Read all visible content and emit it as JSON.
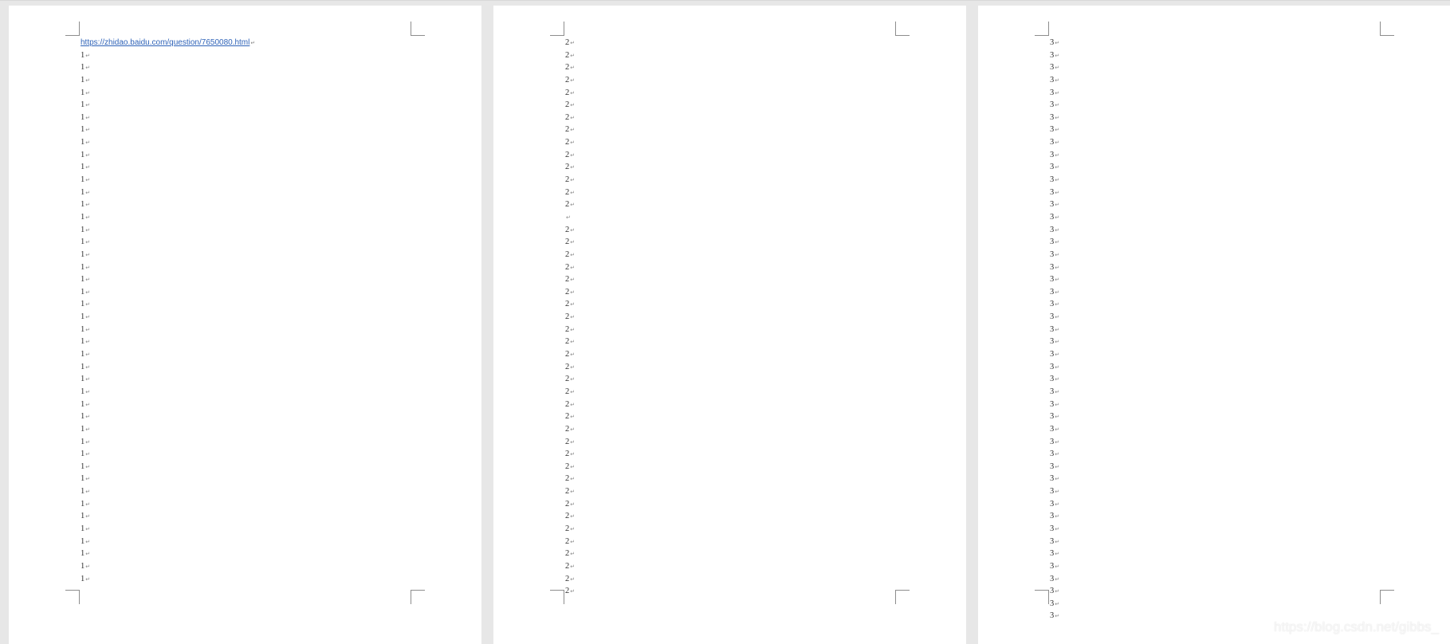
{
  "document": {
    "pages": [
      {
        "name": "page-1",
        "link_text": "https://zhidao.baidu.com/question/7650080.html",
        "lines": [
          "1",
          "1",
          "1",
          "1",
          "1",
          "1",
          "1",
          "1",
          "1",
          "1",
          "1",
          "1",
          "1",
          "1",
          "1",
          "1",
          "1",
          "1",
          "1",
          "1",
          "1",
          "1",
          "1",
          "1",
          "1",
          "1",
          "1",
          "1",
          "1",
          "1",
          "1",
          "1",
          "1",
          "1",
          "1",
          "1",
          "1",
          "1",
          "1",
          "1",
          "1",
          "1",
          "1"
        ]
      },
      {
        "name": "page-2",
        "lines": [
          "2",
          "2",
          "2",
          "2",
          "2",
          "2",
          "2",
          "2",
          "2",
          "2",
          "2",
          "2",
          "2",
          "2",
          "",
          "2",
          "2",
          "2",
          "2",
          "2",
          "2",
          "2",
          "2",
          "2",
          "2",
          "2",
          "2",
          "2",
          "2",
          "2",
          "2",
          "2",
          "2",
          "2",
          "2",
          "2",
          "2",
          "2",
          "2",
          "2",
          "2",
          "2",
          "2",
          "2",
          "2"
        ]
      },
      {
        "name": "page-3",
        "lines": [
          "3",
          "3",
          "3",
          "3",
          "3",
          "3",
          "3",
          "3",
          "3",
          "3",
          "3",
          "3",
          "3",
          "3",
          "3",
          "3",
          "3",
          "3",
          "3",
          "3",
          "3",
          "3",
          "3",
          "3",
          "3",
          "3",
          "3",
          "3",
          "3",
          "3",
          "3",
          "3",
          "3",
          "3",
          "3",
          "3",
          "3",
          "3",
          "3",
          "3",
          "3",
          "3",
          "3",
          "3",
          "3",
          "3",
          "3"
        ]
      }
    ],
    "watermark_text": "https://blog.csdn.net/gibbs_"
  }
}
